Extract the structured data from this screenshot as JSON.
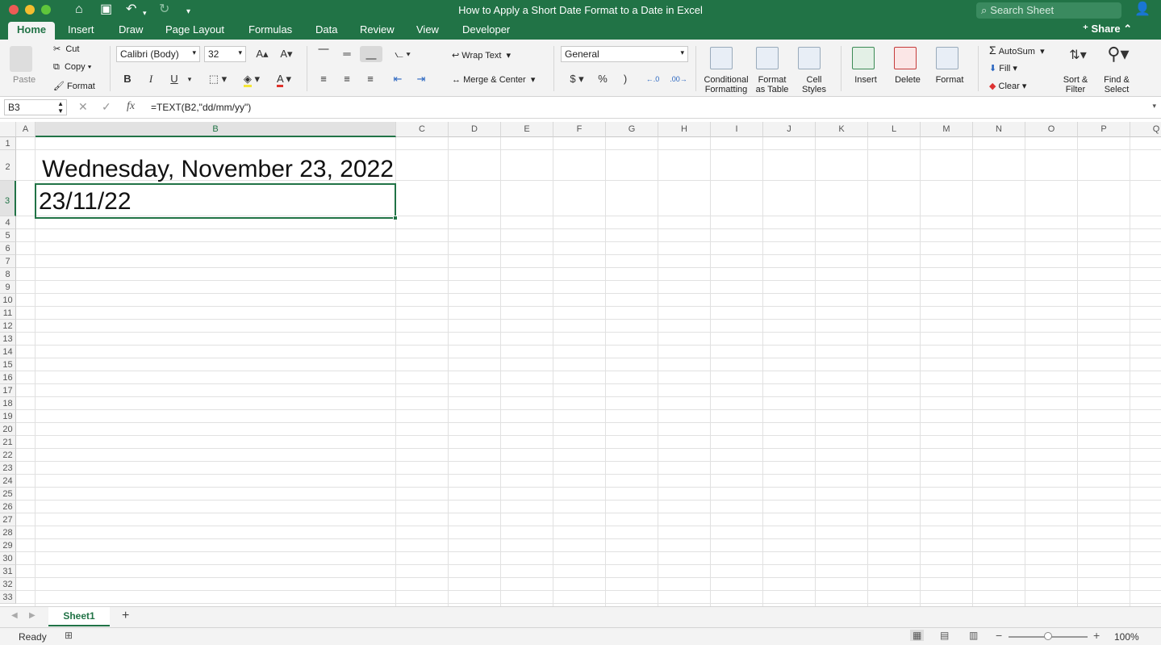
{
  "window": {
    "title": "How to Apply a Short Date Format to a Date in Excel",
    "search_placeholder": "Search Sheet"
  },
  "tabs": [
    "Home",
    "Insert",
    "Draw",
    "Page Layout",
    "Formulas",
    "Data",
    "Review",
    "View",
    "Developer"
  ],
  "share_label": "Share",
  "clipboard": {
    "paste": "Paste",
    "cut": "Cut",
    "copy": "Copy",
    "format": "Format"
  },
  "font": {
    "name": "Calibri (Body)",
    "size": "32",
    "bold": "B",
    "italic": "I",
    "underline": "U"
  },
  "alignment": {
    "wrap_text": "Wrap Text",
    "merge_center": "Merge & Center"
  },
  "number": {
    "format": "General",
    "currency": "$",
    "percent": "%",
    "comma": ")"
  },
  "styles": {
    "conditional": "Conditional",
    "conditional2": "Formatting",
    "format_as": "Format",
    "format_as2": "as Table",
    "cell": "Cell",
    "cell2": "Styles"
  },
  "cells": {
    "insert": "Insert",
    "delete": "Delete",
    "format": "Format"
  },
  "editing": {
    "autosum": "AutoSum",
    "fill": "Fill",
    "clear": "Clear",
    "sort": "Sort &",
    "sort2": "Filter",
    "find": "Find &",
    "find2": "Select"
  },
  "formula_bar": {
    "name_box": "B3",
    "formula": "=TEXT(B2,\"dd/mm/yy\")",
    "fx": "fx"
  },
  "columns": [
    "A",
    "B",
    "C",
    "D",
    "E",
    "F",
    "G",
    "H",
    "I",
    "J",
    "K",
    "L",
    "M",
    "N",
    "O",
    "P",
    "Q"
  ],
  "rows": [
    "1",
    "2",
    "3",
    "4",
    "5",
    "6",
    "7",
    "8",
    "9",
    "10",
    "11",
    "12",
    "13",
    "14",
    "15",
    "16",
    "17",
    "18",
    "19",
    "20",
    "21",
    "22",
    "23",
    "24",
    "25",
    "26",
    "27",
    "28",
    "29",
    "30",
    "31",
    "32",
    "33"
  ],
  "cells_data": {
    "B2": "Wednesday, November 23, 2022",
    "B3": "23/11/22"
  },
  "sheet": {
    "tab": "Sheet1",
    "add": "+"
  },
  "status": {
    "ready": "Ready",
    "zoom": "100%"
  },
  "colors": {
    "accent": "#217346"
  }
}
